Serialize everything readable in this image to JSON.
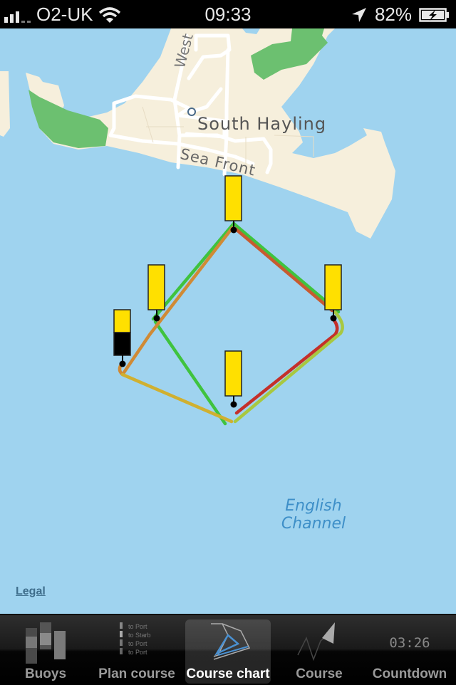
{
  "status_bar": {
    "carrier": "O2-UK",
    "time": "09:33",
    "battery_percent": "82%",
    "signal_bars": 3,
    "icons": [
      "signal-bars-icon",
      "wifi-icon",
      "location-arrow-icon",
      "battery-charging-icon"
    ]
  },
  "map": {
    "labels": {
      "town": "South Hayling",
      "road_sea_front": "Sea Front",
      "road_west": "West",
      "water": "English Channel"
    },
    "legal_link": "Legal",
    "colors": {
      "water": "#9fd3ef",
      "land": "#f6efdc",
      "park": "#6cc070",
      "buoy_yellow": "#ffe000",
      "buoy_black": "#000000"
    },
    "buoys": [
      {
        "name": "buoy-north",
        "style": "yellow"
      },
      {
        "name": "buoy-west",
        "style": "yellow"
      },
      {
        "name": "buoy-start",
        "style": "yellow-black"
      },
      {
        "name": "buoy-east",
        "style": "yellow"
      },
      {
        "name": "buoy-south",
        "style": "yellow"
      }
    ],
    "course_legs_colors": [
      "#3fc33f",
      "#d08a35",
      "#c85a30",
      "#c4302a",
      "#a8c840",
      "#d0b030"
    ]
  },
  "tab_bar": {
    "tabs": [
      {
        "label": "Buoys",
        "icon": "buoys-icon",
        "active": false
      },
      {
        "label": "Plan course",
        "icon": "plan-course-icon",
        "active": false
      },
      {
        "label": "Course chart",
        "icon": "course-chart-icon",
        "active": true
      },
      {
        "label": "Course",
        "icon": "course-icon",
        "active": false
      },
      {
        "label": "Countdown",
        "icon": "countdown-icon",
        "active": false
      }
    ],
    "plan_course_icon_lines": [
      "to Port",
      "to Starb",
      "to Port",
      "to Port"
    ],
    "countdown_icon_text": "03:26"
  }
}
